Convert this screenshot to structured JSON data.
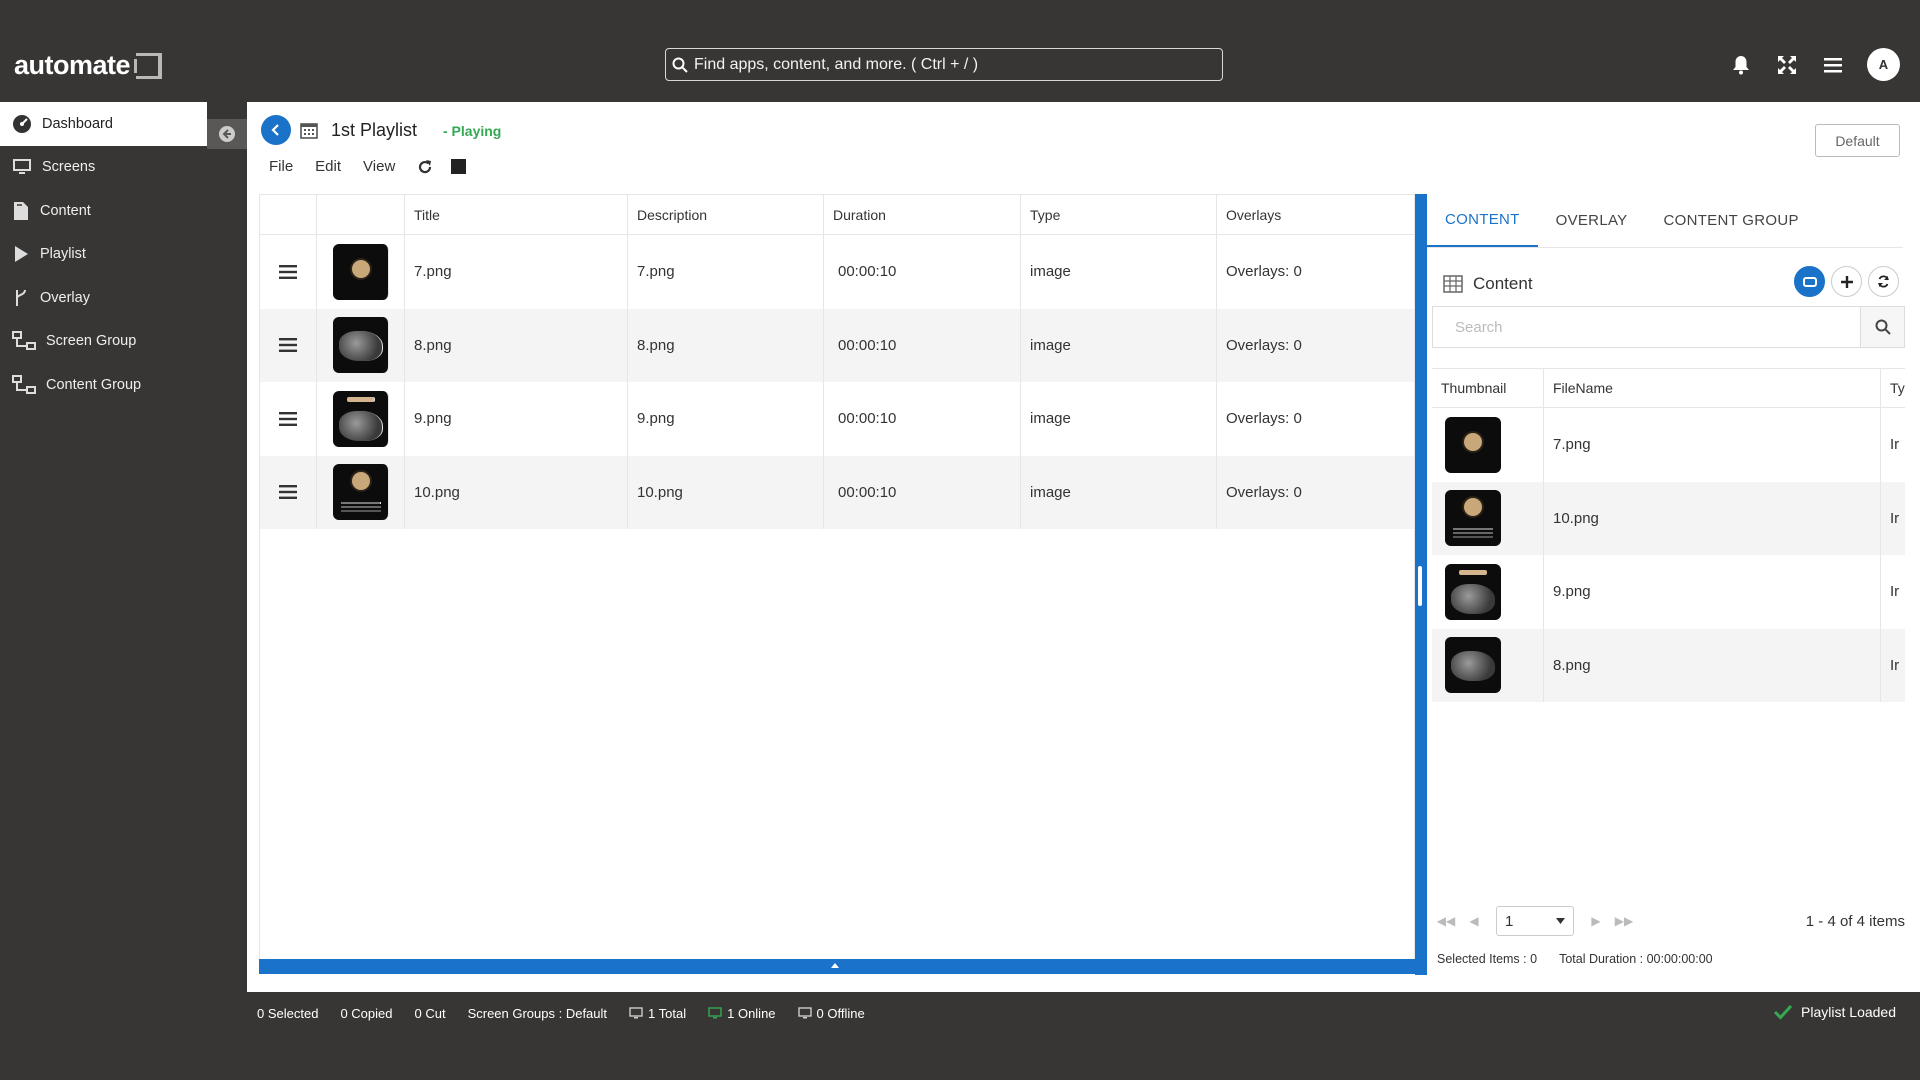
{
  "header": {
    "logo": "automate",
    "search_placeholder": "Find apps, content, and more. ( Ctrl + / )",
    "avatar": "A"
  },
  "sidebar": {
    "items": [
      {
        "label": "Dashboard",
        "icon": "dashboard-icon"
      },
      {
        "label": "Screens",
        "icon": "monitor-icon"
      },
      {
        "label": "Content",
        "icon": "file-icon"
      },
      {
        "label": "Playlist",
        "icon": "play-icon"
      },
      {
        "label": "Overlay",
        "icon": "branch-icon"
      },
      {
        "label": "Screen Group",
        "icon": "hierarchy-icon"
      },
      {
        "label": "Content Group",
        "icon": "hierarchy-icon"
      }
    ]
  },
  "playlist": {
    "title": "1st Playlist",
    "status": "- Playing",
    "default_button": "Default",
    "menu": {
      "file": "File",
      "edit": "Edit",
      "view": "View"
    },
    "columns": {
      "title": "Title",
      "description": "Description",
      "duration": "Duration",
      "type": "Type",
      "overlays": "Overlays"
    },
    "rows": [
      {
        "title": "7.png",
        "description": "7.png",
        "duration": "00:00:10",
        "type": "image",
        "overlays": "Overlays: 0",
        "thumb": "badge"
      },
      {
        "title": "8.png",
        "description": "8.png",
        "duration": "00:00:10",
        "type": "image",
        "overlays": "Overlays: 0",
        "thumb": "rock"
      },
      {
        "title": "9.png",
        "description": "9.png",
        "duration": "00:00:10",
        "type": "image",
        "overlays": "Overlays: 0",
        "thumb": "band"
      },
      {
        "title": "10.png",
        "description": "10.png",
        "duration": "00:00:10",
        "type": "image",
        "overlays": "Overlays: 0",
        "thumb": "badge-text"
      }
    ]
  },
  "right_panel": {
    "tabs": [
      "CONTENT",
      "OVERLAY",
      "CONTENT GROUP"
    ],
    "content_title": "Content",
    "search_placeholder": "Search",
    "columns": {
      "thumbnail": "Thumbnail",
      "filename": "FileName",
      "type": "Ty"
    },
    "rows": [
      {
        "filename": "7.png",
        "type": "Ir",
        "thumb": "badge"
      },
      {
        "filename": "10.png",
        "type": "Ir",
        "thumb": "badge-text"
      },
      {
        "filename": "9.png",
        "type": "Ir",
        "thumb": "band"
      },
      {
        "filename": "8.png",
        "type": "Ir",
        "thumb": "rock"
      }
    ],
    "pager": {
      "page": "1",
      "info": "1 - 4 of 4 items"
    },
    "footer": {
      "selected": "Selected Items : 0",
      "total_duration": "Total Duration : 00:00:00:00"
    }
  },
  "statusbar": {
    "selected": "0 Selected",
    "copied": "0 Copied",
    "cut": "0 Cut",
    "screen_groups": "Screen Groups :  Default",
    "total": "1 Total",
    "online": "1 Online",
    "offline": "0 Offline",
    "right": "Playlist Loaded"
  },
  "colors": {
    "accent": "#1a73c9",
    "status_green": "#34a853",
    "chrome": "#383634"
  }
}
